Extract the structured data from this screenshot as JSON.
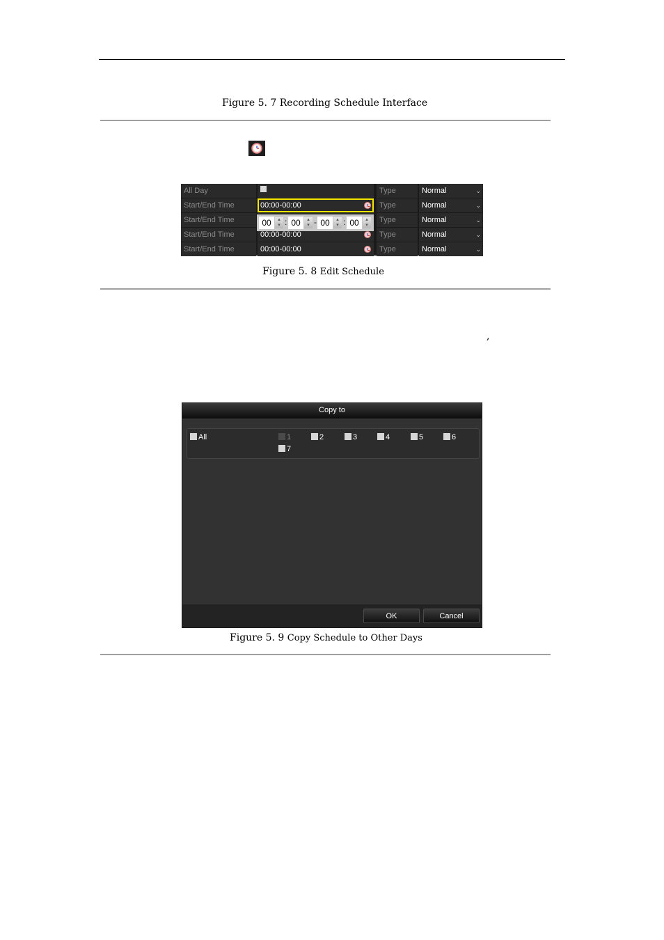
{
  "figures": {
    "fig_5_7": {
      "number": "Figure 5. 7",
      "title": "Recording Schedule Interface"
    },
    "fig_5_8": {
      "number": "Figure 5. 8",
      "title": "Edit Schedule"
    },
    "fig_5_9": {
      "number": "Figure 5. 9",
      "title": "Copy Schedule to Other Days"
    }
  },
  "inline_icon": "clock-icon",
  "stray_text": ",",
  "edit_schedule": {
    "all_day": {
      "label": "All Day",
      "checked": false,
      "type_label": "Type",
      "type_value": "Normal"
    },
    "rows": [
      {
        "label": "Start/End Time",
        "value": "00:00-00:00",
        "type_label": "Type",
        "type_value": "Normal",
        "focused": true
      },
      {
        "label": "Start/End Time",
        "value": "",
        "type_label": "Type",
        "type_value": "Normal"
      },
      {
        "label": "Start/End Time",
        "value": "00:00-00:00",
        "type_label": "Type",
        "type_value": "Normal"
      },
      {
        "label": "Start/End Time",
        "value": "00:00-00:00",
        "type_label": "Type",
        "type_value": "Normal"
      }
    ],
    "time_picker": {
      "start_hour": "00",
      "start_minute": "00",
      "end_hour": "00",
      "end_minute": "00",
      "colon": ":",
      "dash": "-"
    },
    "accent_color": "#f5e800"
  },
  "copy_dialog": {
    "title": "Copy to",
    "all_label": "All",
    "days": [
      {
        "label": "1",
        "disabled": true
      },
      {
        "label": "2"
      },
      {
        "label": "3"
      },
      {
        "label": "4"
      },
      {
        "label": "5"
      },
      {
        "label": "6"
      },
      {
        "label": "7"
      }
    ],
    "ok_label": "OK",
    "cancel_label": "Cancel"
  }
}
